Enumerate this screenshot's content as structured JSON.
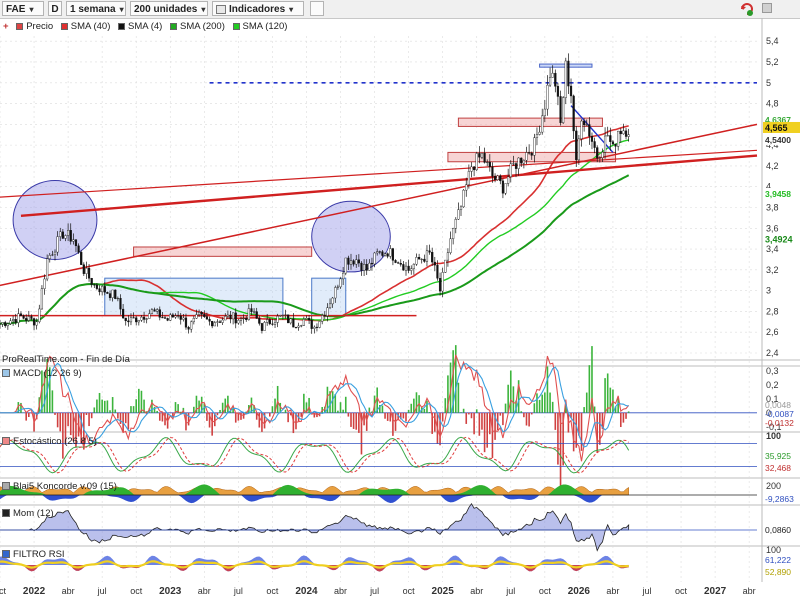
{
  "toolbar": {
    "ticker": "FAE",
    "d_label": "D",
    "period": "1 semana",
    "units": "200 unidades",
    "indicators": "Indicadores"
  },
  "legend": {
    "price_label": "Precio",
    "items": [
      {
        "label": "SMA (40)",
        "color": "#e03030"
      },
      {
        "label": "SMA (4)",
        "color": "#111111"
      },
      {
        "label": "SMA (200)",
        "color": "#22aa22"
      },
      {
        "label": "SMA (120)",
        "color": "#22cc22"
      }
    ]
  },
  "source_label": "ProRealTime.com - Fin de Día",
  "panels": {
    "macd": "MACD (12 26 9)",
    "stoch": "Estocástico (26 8 5)",
    "blai": "Blai5 Koncorde v.09 (15)",
    "mom": "Mom (12)",
    "rsi": "FILTRO RSI"
  },
  "chart_data": [
    {
      "type": "candlestick",
      "title": "FAE",
      "y_ticks": [
        2.4,
        2.6,
        2.8,
        3,
        3.2,
        3.4,
        3.6,
        3.8,
        4,
        4.2,
        4.4,
        4.6,
        4.8,
        5,
        5.2,
        5.4
      ],
      "y_tick_labels": [
        "2,4",
        "2,6",
        "2,8",
        "3",
        "3,2",
        "3,4",
        "3,6",
        "3,8",
        "4",
        "4,2",
        "4,4",
        "4,6",
        "4,8",
        "5",
        "5,2",
        "5,4"
      ],
      "ylim": [
        2.4,
        5.45
      ],
      "x_ticks": [
        "oct",
        "2022",
        "abr",
        "jul",
        "oct",
        "2023",
        "abr",
        "jul",
        "oct",
        "2024",
        "abr",
        "jul",
        "oct",
        "2025",
        "abr",
        "jul",
        "oct",
        "2026",
        "abr",
        "jul",
        "oct",
        "2027",
        "abr"
      ],
      "x_tick_index": [
        0,
        13,
        26,
        39,
        52,
        65,
        78,
        91,
        104,
        117,
        130,
        143,
        156,
        169,
        182,
        195,
        208,
        221,
        234,
        247,
        260,
        273,
        286
      ],
      "close_anchors": [
        [
          0,
          2.68
        ],
        [
          8,
          2.75
        ],
        [
          14,
          2.7
        ],
        [
          18,
          3.3
        ],
        [
          24,
          3.55
        ],
        [
          28,
          3.5
        ],
        [
          32,
          3.2
        ],
        [
          36,
          3.05
        ],
        [
          40,
          3.0
        ],
        [
          44,
          2.95
        ],
        [
          48,
          2.7
        ],
        [
          54,
          2.75
        ],
        [
          58,
          2.8
        ],
        [
          64,
          2.72
        ],
        [
          68,
          2.78
        ],
        [
          72,
          2.65
        ],
        [
          76,
          2.75
        ],
        [
          80,
          2.7
        ],
        [
          84,
          2.72
        ],
        [
          88,
          2.75
        ],
        [
          92,
          2.72
        ],
        [
          96,
          2.8
        ],
        [
          100,
          2.65
        ],
        [
          104,
          2.72
        ],
        [
          108,
          2.75
        ],
        [
          112,
          2.68
        ],
        [
          116,
          2.72
        ],
        [
          120,
          2.65
        ],
        [
          124,
          2.8
        ],
        [
          128,
          3.0
        ],
        [
          132,
          3.3
        ],
        [
          136,
          3.3
        ],
        [
          140,
          3.2
        ],
        [
          144,
          3.35
        ],
        [
          148,
          3.38
        ],
        [
          152,
          3.3
        ],
        [
          156,
          3.2
        ],
        [
          160,
          3.3
        ],
        [
          164,
          3.35
        ],
        [
          166,
          3.2
        ],
        [
          168,
          3.0
        ],
        [
          172,
          3.5
        ],
        [
          176,
          3.8
        ],
        [
          180,
          4.2
        ],
        [
          184,
          4.3
        ],
        [
          188,
          4.1
        ],
        [
          192,
          4.0
        ],
        [
          196,
          4.2
        ],
        [
          200,
          4.3
        ],
        [
          204,
          4.4
        ],
        [
          208,
          4.8
        ],
        [
          210,
          5.1
        ],
        [
          212,
          5.0
        ],
        [
          214,
          4.6
        ],
        [
          216,
          5.15
        ],
        [
          218,
          4.9
        ],
        [
          220,
          4.2
        ],
        [
          222,
          4.7
        ],
        [
          224,
          4.6
        ],
        [
          228,
          4.3
        ],
        [
          232,
          4.5
        ],
        [
          234,
          4.35
        ],
        [
          236,
          4.55
        ],
        [
          240,
          4.56
        ]
      ],
      "sma_4": "tracks price",
      "annotations": {
        "current_price": 4.565,
        "current_price_label": "4,565",
        "level_4_6367": "4,6367",
        "level_4_5400": "4,5400",
        "sma_120_value": "3,9458",
        "sma_200_value": "3,4924",
        "resistance_dashed": 5.0,
        "support_line": 2.76
      }
    },
    {
      "type": "line",
      "title": "MACD (12 26 9)",
      "y_ticks": [
        0.3,
        0.2,
        0.1,
        0,
        -0.1
      ],
      "y_tick_labels": [
        "0,3",
        "0,2",
        "0,1",
        "0",
        "-0,1"
      ],
      "value_labels": [
        "0,0048",
        "-0,0087",
        "-0,0132"
      ]
    },
    {
      "type": "line",
      "title": "Estocástico (26 8 5)",
      "y_ticks": [
        100
      ],
      "y_tick_labels": [
        "100"
      ],
      "value_labels": [
        "35,925",
        "32,468"
      ]
    },
    {
      "type": "area",
      "title": "Blai5 Koncorde v.09 (15)",
      "y_ticks": [
        200
      ],
      "y_tick_labels": [
        "200"
      ],
      "value_labels": [
        "-9,2863"
      ]
    },
    {
      "type": "area",
      "title": "Mom (12)",
      "y_ticks": [],
      "y_tick_labels": [],
      "value_labels": [
        "0,0860"
      ]
    },
    {
      "type": "line",
      "title": "FILTRO RSI",
      "y_ticks": [
        100
      ],
      "y_tick_labels": [
        "100"
      ],
      "value_labels": [
        "61,222",
        "52,890"
      ]
    }
  ]
}
